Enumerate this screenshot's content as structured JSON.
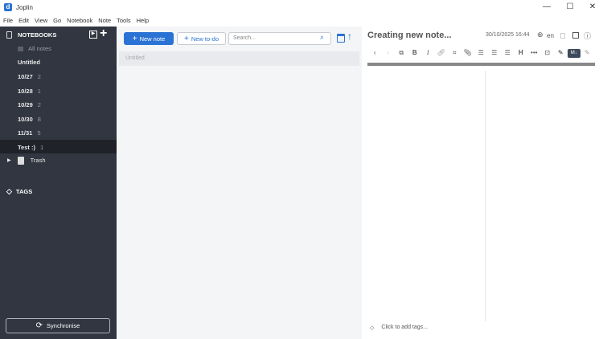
{
  "window": {
    "title": "Joplin",
    "logo_letter": "d",
    "minimize": "—",
    "maximize": "☐",
    "close": "✕"
  },
  "menu": [
    "File",
    "Edit",
    "View",
    "Go",
    "Notebook",
    "Note",
    "Tools",
    "Help"
  ],
  "sidebar": {
    "notebooks_label": "NOTEBOOKS",
    "all_notes": "All notes",
    "notebooks": [
      {
        "name": "Untitled",
        "count": ""
      },
      {
        "name": "10/27",
        "count": "2"
      },
      {
        "name": "10/28",
        "count": "1"
      },
      {
        "name": "10/29",
        "count": "2"
      },
      {
        "name": "10/30",
        "count": "8"
      },
      {
        "name": "11/31",
        "count": "5"
      },
      {
        "name": "Test :)",
        "count": "1"
      }
    ],
    "selected": "Test :)",
    "trash": "Trash",
    "tags_label": "TAGS",
    "sync_label": "Synchronise"
  },
  "notelist": {
    "new_note": "New note",
    "new_todo": "New to-do",
    "search_placeholder": "Search...",
    "notes": [
      "Untitled"
    ]
  },
  "editor": {
    "title_placeholder": "Creating new note...",
    "date": "30/10/2025 16:44",
    "language": "en",
    "tags_placeholder": "Click to add tags..."
  },
  "colors": {
    "sidebar": "#313640",
    "accent": "#2a73d4"
  }
}
